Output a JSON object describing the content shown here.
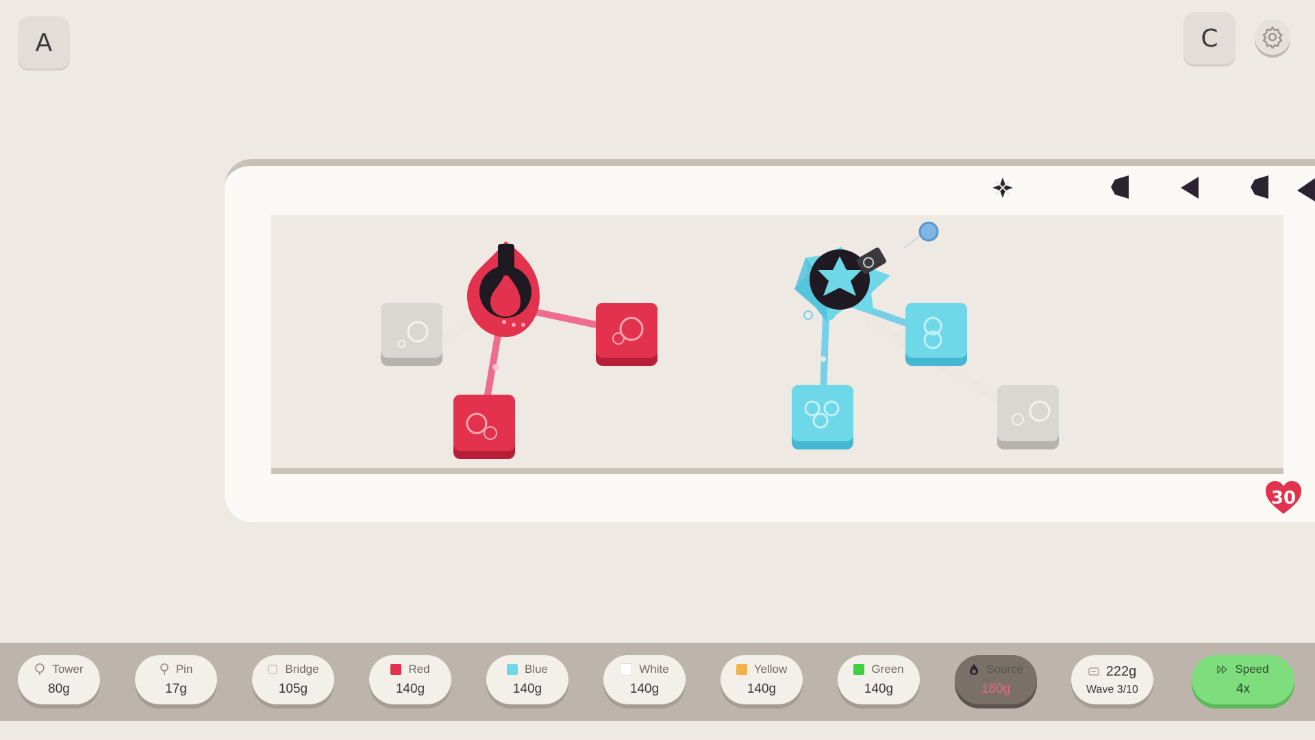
{
  "top_left_button": {
    "label": "A"
  },
  "top_right_button": {
    "label": "C"
  },
  "lives": {
    "value": "30"
  },
  "colors": {
    "red": "#e2324e",
    "blue": "#6fd8e8",
    "white": "#d9d7d1",
    "yellow": "#f2b24a",
    "green": "#3fcf3f",
    "enemy": "#2b2430"
  },
  "toolbar": {
    "items": [
      {
        "label": "Tower",
        "cost": "80g",
        "icon": "tower-icon"
      },
      {
        "label": "Pin",
        "cost": "17g",
        "icon": "pin-icon"
      },
      {
        "label": "Bridge",
        "cost": "105g",
        "icon": "bridge-icon"
      },
      {
        "label": "Red",
        "cost": "140g",
        "icon": "red-swatch"
      },
      {
        "label": "Blue",
        "cost": "140g",
        "icon": "blue-swatch"
      },
      {
        "label": "White",
        "cost": "140g",
        "icon": "white-swatch"
      },
      {
        "label": "Yellow",
        "cost": "140g",
        "icon": "yellow-swatch"
      },
      {
        "label": "Green",
        "cost": "140g",
        "icon": "green-swatch"
      },
      {
        "label": "Source",
        "cost": "180g",
        "icon": "source-icon",
        "disabled": true
      }
    ],
    "gold": {
      "amount": "222g",
      "wave": "Wave 3/10"
    },
    "speed": {
      "label": "Speed",
      "value": "4x"
    }
  }
}
